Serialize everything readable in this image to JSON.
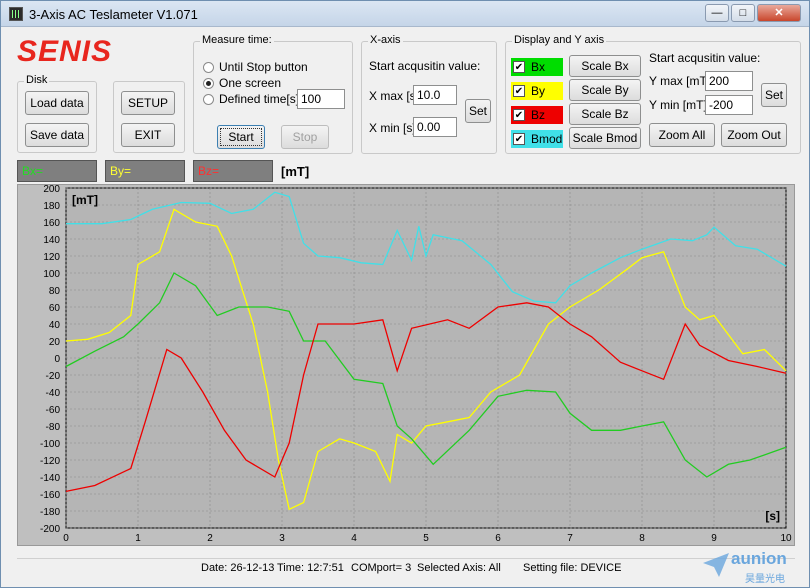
{
  "window": {
    "title": "3-Axis AC Teslameter V1.071",
    "min": "—",
    "max": "□",
    "close": "✕"
  },
  "logo": "SENIS",
  "disk": {
    "label": "Disk",
    "load": "Load data",
    "save": "Save data"
  },
  "misc": {
    "setup": "SETUP",
    "exit": "EXIT"
  },
  "measure": {
    "label": "Measure time:",
    "options": [
      "Until Stop button",
      "One screen",
      "Defined time[s]:"
    ],
    "selected": 1,
    "defined_value": "100",
    "start": "Start",
    "stop": "Stop"
  },
  "xaxis": {
    "label": "X-axis",
    "start_label": "Start acqusitin value:",
    "xmax_label": "X max [s]",
    "xmax": "10.0",
    "xmin_label": "X min [s]",
    "xmin": "0.00",
    "set": "Set"
  },
  "display": {
    "label": "Display and Y axis",
    "channels": [
      {
        "name": "Bx",
        "checked": true,
        "color": "#00dd00",
        "scale": "Scale Bx"
      },
      {
        "name": "By",
        "checked": true,
        "color": "#ffff00",
        "scale": "Scale By"
      },
      {
        "name": "Bz",
        "checked": true,
        "color": "#ee0000",
        "scale": "Scale Bz"
      },
      {
        "name": "Bmod",
        "checked": true,
        "color": "#40e0e8",
        "scale": "Scale Bmod"
      }
    ],
    "start_label": "Start acqusitin value:",
    "ymax_label": "Y max [mT]",
    "ymax": "200",
    "ymin_label": "Y min [mT]",
    "ymin": "-200",
    "set": "Set",
    "zoom_all": "Zoom All",
    "zoom_out": "Zoom Out"
  },
  "readouts": {
    "bx": "Bx=",
    "by": "By=",
    "bz": "Bz=",
    "unit": "[mT]"
  },
  "status": {
    "date": "Date: 26-12-13",
    "time": "Time: 12:7:51",
    "port": "COMport= 3",
    "axis": "Selected Axis: All",
    "file": "Setting file: DEVICE"
  },
  "watermark": {
    "brand": "aunion",
    "sub": "昊量光电"
  },
  "chart_data": {
    "type": "line",
    "ylabel": "[mT]",
    "xlabel": "[s]",
    "xlim": [
      0,
      10
    ],
    "ylim": [
      -200,
      200
    ],
    "grid": true,
    "x_ticks": [
      0,
      1,
      2,
      3,
      4,
      5,
      6,
      7,
      8,
      9,
      10
    ],
    "y_ticks": [
      200,
      180,
      160,
      140,
      120,
      100,
      80,
      60,
      40,
      20,
      0,
      -20,
      -40,
      -60,
      -80,
      -100,
      -120,
      -140,
      -160,
      -180,
      -200
    ],
    "series": [
      {
        "name": "Bmod",
        "color": "#40e0e8",
        "x": [
          0,
          0.5,
          0.9,
          1.2,
          1.6,
          2.0,
          2.3,
          2.6,
          2.9,
          3.1,
          3.3,
          3.5,
          3.8,
          4.1,
          4.4,
          4.6,
          4.8,
          4.9,
          5.0,
          5.1,
          5.5,
          5.9,
          6.2,
          6.5,
          6.8,
          7.0,
          7.3,
          7.7,
          8.0,
          8.4,
          8.7,
          8.9,
          9.0,
          9.3,
          9.6,
          10.0
        ],
        "y": [
          158,
          158,
          163,
          175,
          183,
          182,
          170,
          175,
          195,
          190,
          135,
          120,
          118,
          112,
          110,
          150,
          115,
          155,
          120,
          145,
          138,
          110,
          78,
          67,
          65,
          85,
          100,
          118,
          128,
          140,
          138,
          145,
          154,
          132,
          128,
          108
        ]
      },
      {
        "name": "By",
        "color": "#ffff00",
        "x": [
          0,
          0.3,
          0.6,
          0.9,
          1.0,
          1.3,
          1.5,
          1.8,
          2.1,
          2.3,
          2.6,
          2.8,
          2.95,
          3.1,
          3.3,
          3.5,
          3.8,
          4.0,
          4.3,
          4.5,
          4.6,
          4.8,
          5.0,
          5.3,
          5.6,
          5.9,
          6.3,
          6.7,
          7.0,
          7.4,
          7.8,
          8.0,
          8.3,
          8.6,
          8.8,
          9.0,
          9.4,
          9.7,
          10.0
        ],
        "y": [
          20,
          22,
          30,
          50,
          110,
          125,
          175,
          160,
          155,
          120,
          40,
          -40,
          -120,
          -178,
          -170,
          -110,
          -95,
          -100,
          -110,
          -145,
          -90,
          -100,
          -80,
          -75,
          -70,
          -40,
          -20,
          40,
          60,
          80,
          105,
          118,
          125,
          60,
          45,
          50,
          5,
          10,
          -15
        ]
      },
      {
        "name": "Bx",
        "color": "#22cc22",
        "x": [
          0,
          0.4,
          0.8,
          1.0,
          1.3,
          1.5,
          1.8,
          2.1,
          2.4,
          2.8,
          3.1,
          3.3,
          3.6,
          4.0,
          4.4,
          4.6,
          4.8,
          5.1,
          5.6,
          6.0,
          6.4,
          6.8,
          7.0,
          7.3,
          7.7,
          8.0,
          8.3,
          8.6,
          8.9,
          9.2,
          9.5,
          10.0
        ],
        "y": [
          -10,
          8,
          25,
          40,
          65,
          100,
          85,
          50,
          60,
          60,
          55,
          20,
          20,
          -25,
          -30,
          -80,
          -95,
          -125,
          -85,
          -45,
          -38,
          -40,
          -65,
          -85,
          -85,
          -80,
          -75,
          -120,
          -140,
          -125,
          -120,
          -105
        ]
      },
      {
        "name": "Bz",
        "color": "#ee0000",
        "x": [
          0,
          0.4,
          0.9,
          1.1,
          1.4,
          1.6,
          1.9,
          2.2,
          2.5,
          2.9,
          3.1,
          3.3,
          3.5,
          4.0,
          4.4,
          4.6,
          4.8,
          5.3,
          5.6,
          6.0,
          6.4,
          6.7,
          7.0,
          7.3,
          7.7,
          8.0,
          8.3,
          8.6,
          8.8,
          9.2,
          9.6,
          10.0
        ],
        "y": [
          -157,
          -150,
          -130,
          -75,
          10,
          0,
          -40,
          -85,
          -120,
          -140,
          -100,
          -20,
          40,
          40,
          45,
          -15,
          35,
          45,
          35,
          60,
          65,
          60,
          40,
          25,
          -5,
          -15,
          -25,
          40,
          15,
          -3,
          -10,
          -18
        ]
      }
    ]
  }
}
